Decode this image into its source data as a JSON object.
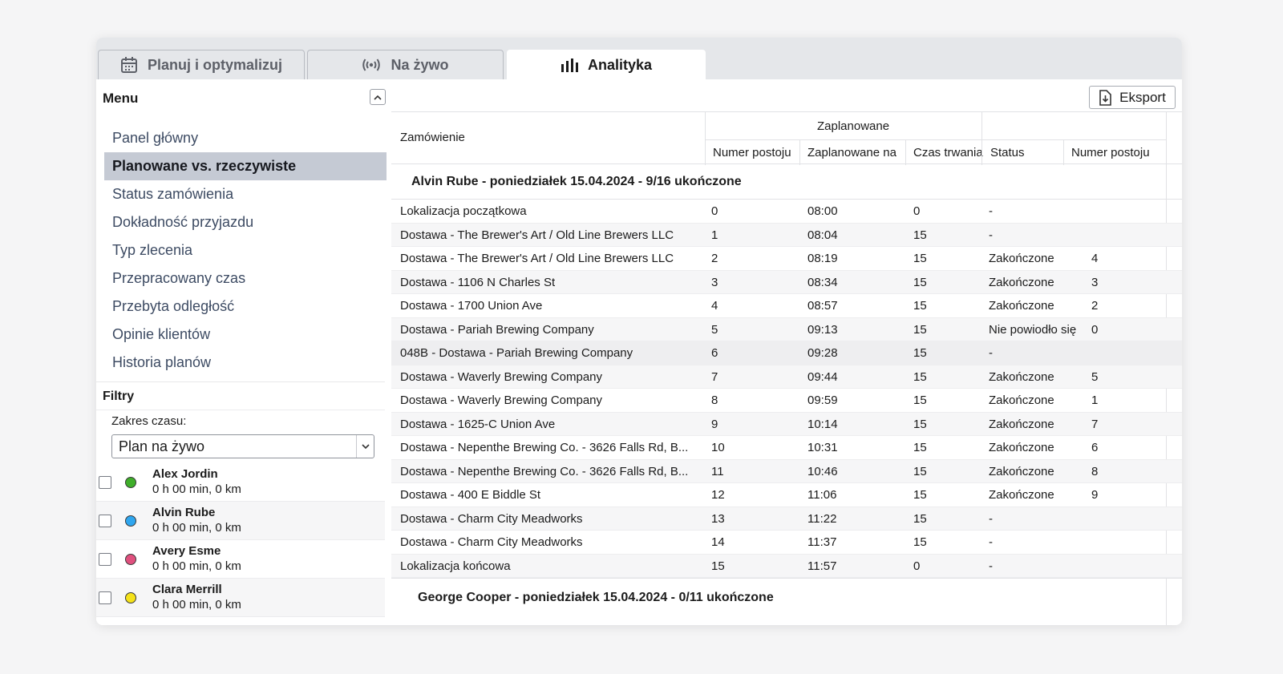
{
  "tabs": [
    {
      "label": "Planuj i optymalizuj",
      "icon": "calendar-icon"
    },
    {
      "label": "Na żywo",
      "icon": "broadcast-icon"
    },
    {
      "label": "Analityka",
      "icon": "bar-chart-icon",
      "active": true
    }
  ],
  "sidebar": {
    "menu_title": "Menu",
    "items": [
      {
        "label": "Panel główny"
      },
      {
        "label": "Planowane vs. rzeczywiste",
        "active": true
      },
      {
        "label": "Status zamówienia"
      },
      {
        "label": "Dokładność przyjazdu"
      },
      {
        "label": "Typ zlecenia"
      },
      {
        "label": "Przepracowany czas"
      },
      {
        "label": "Przebyta odległość"
      },
      {
        "label": "Opinie klientów"
      },
      {
        "label": "Historia planów"
      }
    ]
  },
  "filters": {
    "title": "Filtry",
    "range_label": "Zakres czasu:",
    "range_value": "Plan na żywo",
    "drivers": [
      {
        "name": "Alex Jordin",
        "meta": "0 h 00 min, 0 km",
        "color": "#3fae2a"
      },
      {
        "name": "Alvin Rube",
        "meta": "0 h 00 min, 0 km",
        "color": "#2fa6ef"
      },
      {
        "name": "Avery Esme",
        "meta": "0 h 00 min, 0 km",
        "color": "#e0507e"
      },
      {
        "name": "Clara Merrill",
        "meta": "0 h 00 min, 0 km",
        "color": "#f5e21a"
      }
    ]
  },
  "main": {
    "export_label": "Eksport",
    "table": {
      "col_order": "Zamówienie",
      "group_planned": "Zaplanowane",
      "col_stop_number": "Numer postoju",
      "col_planned_at": "Zaplanowane na",
      "col_duration": "Czas trwania",
      "col_status": "Status",
      "col_actual_stop": "Numer postoju"
    },
    "groups": [
      {
        "title": "Alvin Rube - poniedziałek 15.04.2024 - 9/16 ukończone",
        "rows": [
          {
            "order": "Lokalizacja początkowa",
            "num": "0",
            "time": "08:00",
            "dur": "0",
            "status": "-",
            "actual": ""
          },
          {
            "order": "Dostawa - The Brewer's Art / Old Line Brewers LLC",
            "num": "1",
            "time": "08:04",
            "dur": "15",
            "status": "-",
            "actual": ""
          },
          {
            "order": "Dostawa - The Brewer's Art / Old Line Brewers LLC",
            "num": "2",
            "time": "08:19",
            "dur": "15",
            "status": "Zakończone",
            "actual": "4"
          },
          {
            "order": "Dostawa - 1106 N Charles St",
            "num": "3",
            "time": "08:34",
            "dur": "15",
            "status": "Zakończone",
            "actual": "3"
          },
          {
            "order": "Dostawa - 1700 Union Ave",
            "num": "4",
            "time": "08:57",
            "dur": "15",
            "status": "Zakończone",
            "actual": "2"
          },
          {
            "order": "Dostawa - Pariah Brewing Company",
            "num": "5",
            "time": "09:13",
            "dur": "15",
            "status": "Nie powiodło się",
            "actual": "0"
          },
          {
            "order": "048B - Dostawa - Pariah Brewing Company",
            "num": "6",
            "time": "09:28",
            "dur": "15",
            "status": "-",
            "actual": ""
          },
          {
            "order": "Dostawa - Waverly Brewing Company",
            "num": "7",
            "time": "09:44",
            "dur": "15",
            "status": "Zakończone",
            "actual": "5"
          },
          {
            "order": "Dostawa - Waverly Brewing Company",
            "num": "8",
            "time": "09:59",
            "dur": "15",
            "status": "Zakończone",
            "actual": "1"
          },
          {
            "order": "Dostawa - 1625-C Union Ave",
            "num": "9",
            "time": "10:14",
            "dur": "15",
            "status": "Zakończone",
            "actual": "7"
          },
          {
            "order": "Dostawa - Nepenthe Brewing Co. - 3626 Falls Rd, B...",
            "num": "10",
            "time": "10:31",
            "dur": "15",
            "status": "Zakończone",
            "actual": "6"
          },
          {
            "order": "Dostawa - Nepenthe Brewing Co. - 3626 Falls Rd, B...",
            "num": "11",
            "time": "10:46",
            "dur": "15",
            "status": "Zakończone",
            "actual": "8"
          },
          {
            "order": "Dostawa - 400 E Biddle St",
            "num": "12",
            "time": "11:06",
            "dur": "15",
            "status": "Zakończone",
            "actual": "9"
          },
          {
            "order": "Dostawa - Charm City Meadworks",
            "num": "13",
            "time": "11:22",
            "dur": "15",
            "status": "-",
            "actual": ""
          },
          {
            "order": "Dostawa - Charm City Meadworks",
            "num": "14",
            "time": "11:37",
            "dur": "15",
            "status": "-",
            "actual": ""
          },
          {
            "order": "Lokalizacja końcowa",
            "num": "15",
            "time": "11:57",
            "dur": "0",
            "status": "-",
            "actual": ""
          }
        ]
      },
      {
        "title": "George Cooper - poniedziałek 15.04.2024 - 0/11 ukończone",
        "rows": []
      }
    ]
  }
}
